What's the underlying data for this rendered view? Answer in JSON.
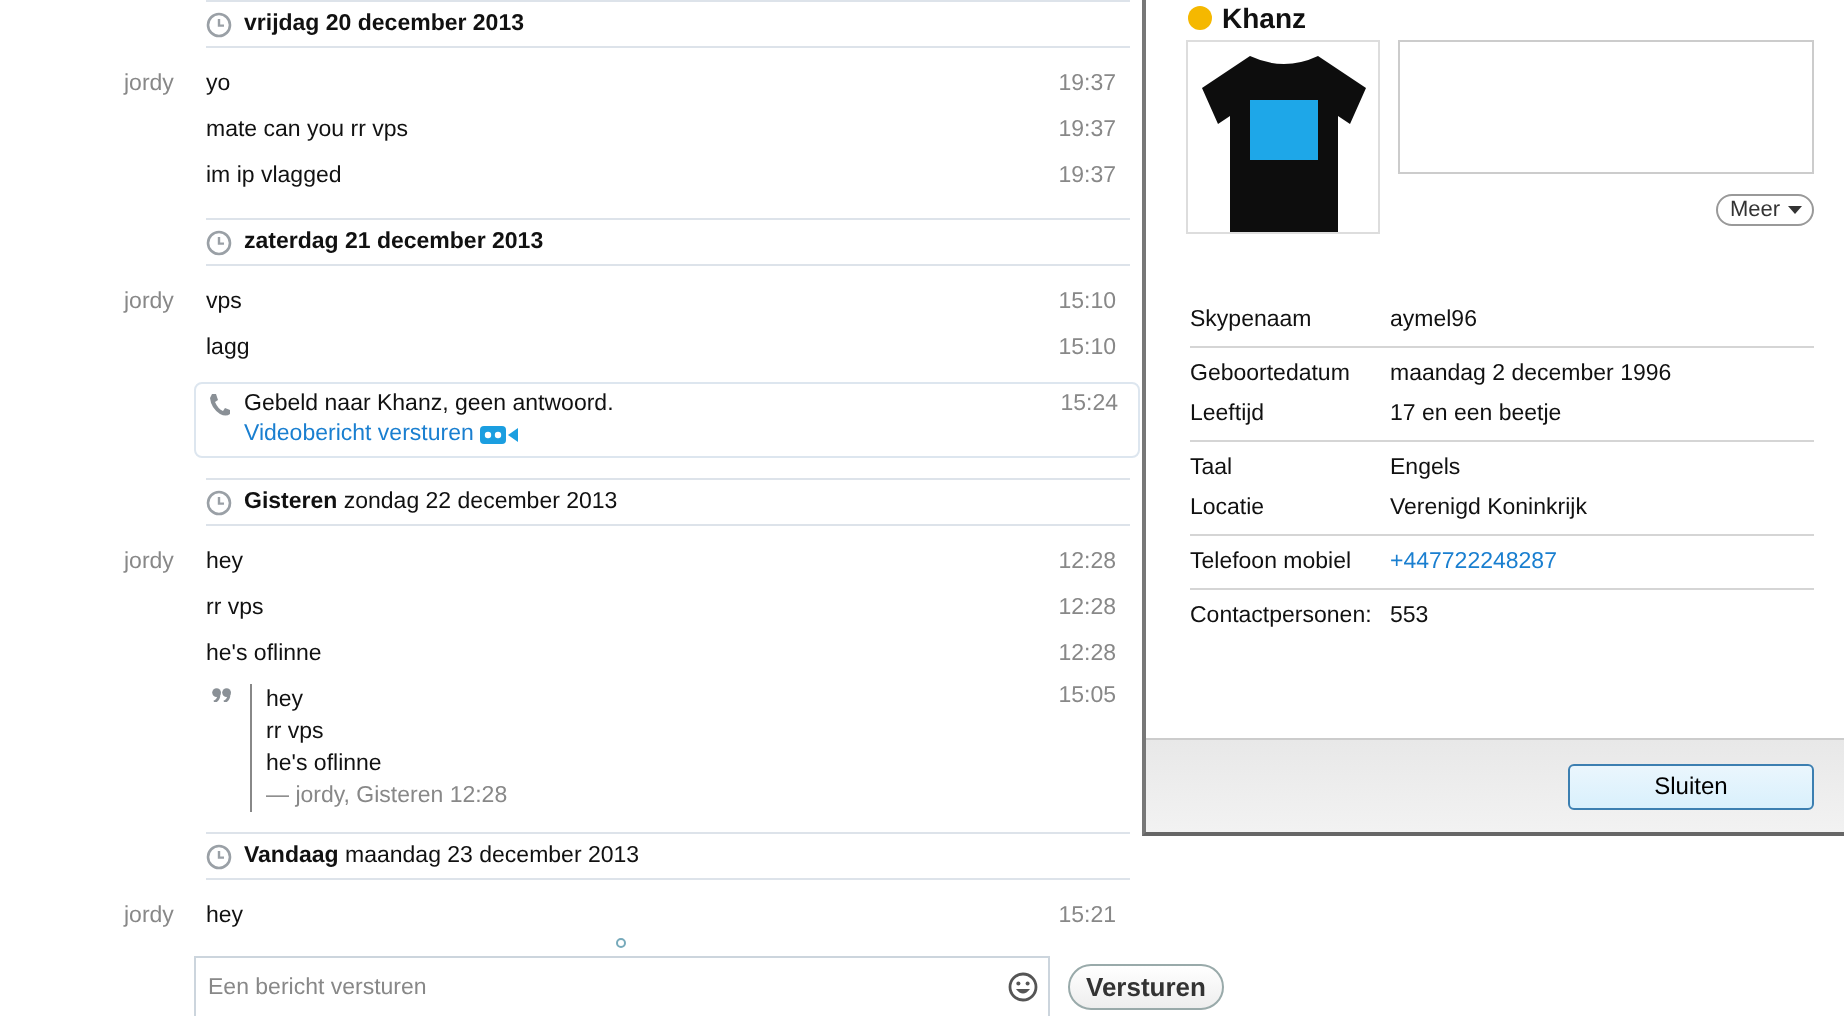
{
  "chat": {
    "days": [
      {
        "header": "**vrijdag 20 december 2013**",
        "messages": [
          {
            "kind": "text",
            "sender": "jordy",
            "text": "yo",
            "time": "19:37"
          },
          {
            "kind": "text",
            "text": "mate can you rr vps",
            "time": "19:37"
          },
          {
            "kind": "text",
            "text": "im ip vlagged",
            "time": "19:37"
          }
        ]
      },
      {
        "header": "**zaterdag 21 december 2013**",
        "messages": [
          {
            "kind": "text",
            "sender": "jordy",
            "text": "vps",
            "time": "15:10"
          },
          {
            "kind": "text",
            "text": "lagg",
            "time": "15:10"
          },
          {
            "kind": "call",
            "text": "Gebeld naar Khanz, geen antwoord.",
            "link": "Videobericht versturen",
            "time": "15:24"
          }
        ]
      },
      {
        "header": "**Gisteren** zondag 22 december 2013",
        "messages": [
          {
            "kind": "text",
            "sender": "jordy",
            "text": "hey",
            "time": "12:28"
          },
          {
            "kind": "text",
            "text": "rr vps",
            "time": "12:28"
          },
          {
            "kind": "text",
            "text": "he's oflinne",
            "time": "12:28"
          },
          {
            "kind": "quote",
            "lines": [
              "hey",
              "rr vps",
              "he's oflinne"
            ],
            "attribution": "— jordy, Gisteren 12:28",
            "time": "15:05"
          }
        ]
      },
      {
        "header": "**Vandaag** maandag 23 december 2013",
        "messages": [
          {
            "kind": "text",
            "sender": "jordy",
            "text": "hey",
            "time": "15:21"
          }
        ]
      }
    ],
    "input": {
      "placeholder": "Een bericht versturen"
    },
    "send_button": "Versturen"
  },
  "profile": {
    "name": "Khanz",
    "more_button": "Meer",
    "groups": [
      [
        {
          "label": "Skypenaam",
          "value": "aymel96"
        }
      ],
      [
        {
          "label": "Geboortedatum",
          "value": "maandag 2 december 1996"
        },
        {
          "label": "Leeftijd",
          "value": "17 en een beetje"
        }
      ],
      [
        {
          "label": "Taal",
          "value": "Engels"
        },
        {
          "label": "Locatie",
          "value": "Verenigd Koninkrijk"
        }
      ],
      [
        {
          "label": "Telefoon mobiel",
          "value": "+447722248287",
          "kind": "link"
        }
      ],
      [
        {
          "label": "Contactpersonen:",
          "value": "553"
        }
      ]
    ],
    "close_button": "Sluiten"
  }
}
